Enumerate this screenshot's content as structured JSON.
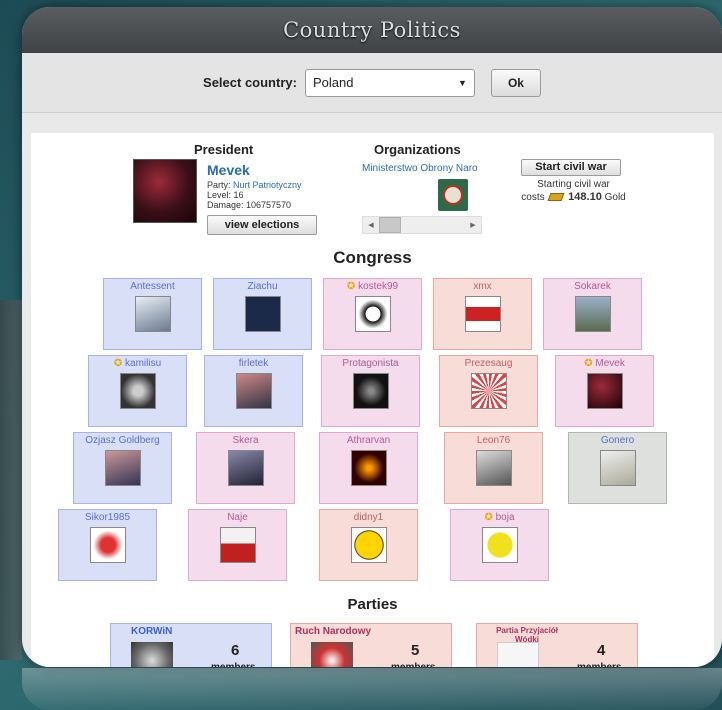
{
  "window": {
    "title": "Country Politics"
  },
  "selector": {
    "label": "Select country:",
    "selected": "Poland",
    "ok_label": "Ok"
  },
  "president": {
    "heading": "President",
    "name": "Mevek",
    "party_prefix": "Party: ",
    "party": "Nurt Patriotyczny",
    "level": "Level: 16",
    "damage": "Damage: 106757570",
    "view_elections": "view elections"
  },
  "organizations": {
    "heading": "Organizations",
    "name": "Ministerstwo Obrony Naro"
  },
  "civil_war": {
    "button": "Start civil war",
    "line1": "Starting civil war",
    "costs": "costs",
    "amount": "148.10",
    "currency": "Gold"
  },
  "congress": {
    "heading": "Congress",
    "members": [
      {
        "name": "Antessent",
        "color": "blue",
        "leader": false
      },
      {
        "name": "Ziachu",
        "color": "blue",
        "leader": false
      },
      {
        "name": "kostek99",
        "color": "pink",
        "leader": true
      },
      {
        "name": "xmx",
        "color": "red",
        "leader": false
      },
      {
        "name": "Sokarek",
        "color": "pink",
        "leader": false
      },
      {
        "name": "kamilisu",
        "color": "blue",
        "leader": true
      },
      {
        "name": "firletek",
        "color": "blue",
        "leader": false
      },
      {
        "name": "Protagonista",
        "color": "pink",
        "leader": false
      },
      {
        "name": "Prezesaug",
        "color": "red",
        "leader": false
      },
      {
        "name": "Mevek",
        "color": "pink",
        "leader": true
      },
      {
        "name": "Ozjasz Goldberg",
        "color": "blue",
        "leader": false
      },
      {
        "name": "Skera",
        "color": "pink",
        "leader": false
      },
      {
        "name": "Athrarvan",
        "color": "pink",
        "leader": false
      },
      {
        "name": "Leon76",
        "color": "red",
        "leader": false
      },
      {
        "name": "Gonero",
        "color": "green",
        "leader": false
      },
      {
        "name": "Sikor1985",
        "color": "blue",
        "leader": false
      },
      {
        "name": "Naje",
        "color": "pink",
        "leader": false
      },
      {
        "name": "didny1",
        "color": "red",
        "leader": false
      },
      {
        "name": "boja",
        "color": "pink",
        "leader": true
      }
    ]
  },
  "parties": {
    "heading": "Parties",
    "items": [
      {
        "name": "KORWiN",
        "count": "6",
        "members_label": "members"
      },
      {
        "name": "Ruch Narodowy",
        "count": "5",
        "members_label": "members"
      },
      {
        "name": "Partia Przyjaciół Wódki",
        "count": "4",
        "members_label": "members"
      }
    ]
  },
  "colors": {
    "blue_tile": "#dadff8",
    "pink_tile": "#f5dcec",
    "red_tile": "#f7dcd8",
    "green_tile": "#dde0dd",
    "link": "#2a6ab8",
    "leader_star": "#e8a800"
  }
}
